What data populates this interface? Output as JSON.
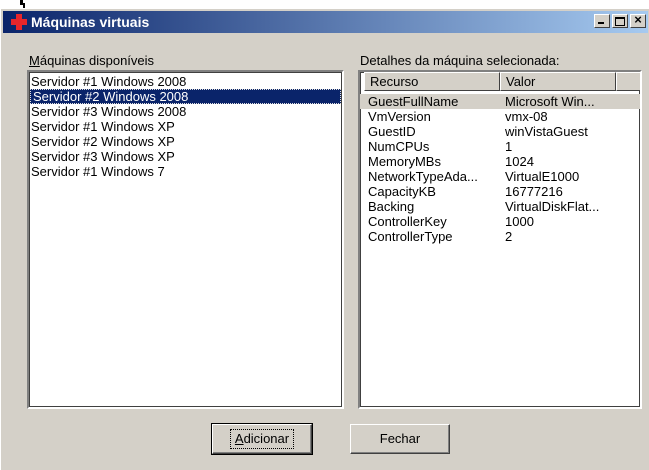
{
  "window": {
    "title": "Máquinas virtuais",
    "controls": {
      "minimize": "_",
      "maximize": "□",
      "close": "×"
    }
  },
  "left_panel": {
    "label_mnemonic": "M",
    "label_rest": "áquinas disponíveis",
    "items": [
      "Servidor #1 Windows 2008",
      "Servidor #2 Windows 2008",
      "Servidor #3 Windows 2008",
      "Servidor #1 Windows XP",
      "Servidor #2 Windows XP",
      "Servidor #3 Windows XP",
      "Servidor #1 Windows 7"
    ],
    "selected_index": 1
  },
  "right_panel": {
    "label": "Detalhes da máquina selecionada:",
    "columns": [
      "Recurso",
      "Valor"
    ],
    "rows": [
      [
        "GuestFullName",
        "Microsoft Win..."
      ],
      [
        "VmVersion",
        "vmx-08"
      ],
      [
        "GuestID",
        "winVistaGuest"
      ],
      [
        "NumCPUs",
        "1"
      ],
      [
        "MemoryMBs",
        "1024"
      ],
      [
        "NetworkTypeAda...",
        "VirtualE1000"
      ],
      [
        "CapacityKB",
        "16777216"
      ],
      [
        "Backing",
        "VirtualDiskFlat..."
      ],
      [
        "ControllerKey",
        "1000"
      ],
      [
        "ControllerType",
        "2"
      ]
    ],
    "highlighted_row": 0
  },
  "buttons": {
    "add_mnemonic": "A",
    "add_rest": "dicionar",
    "close_label": "Fechar"
  }
}
